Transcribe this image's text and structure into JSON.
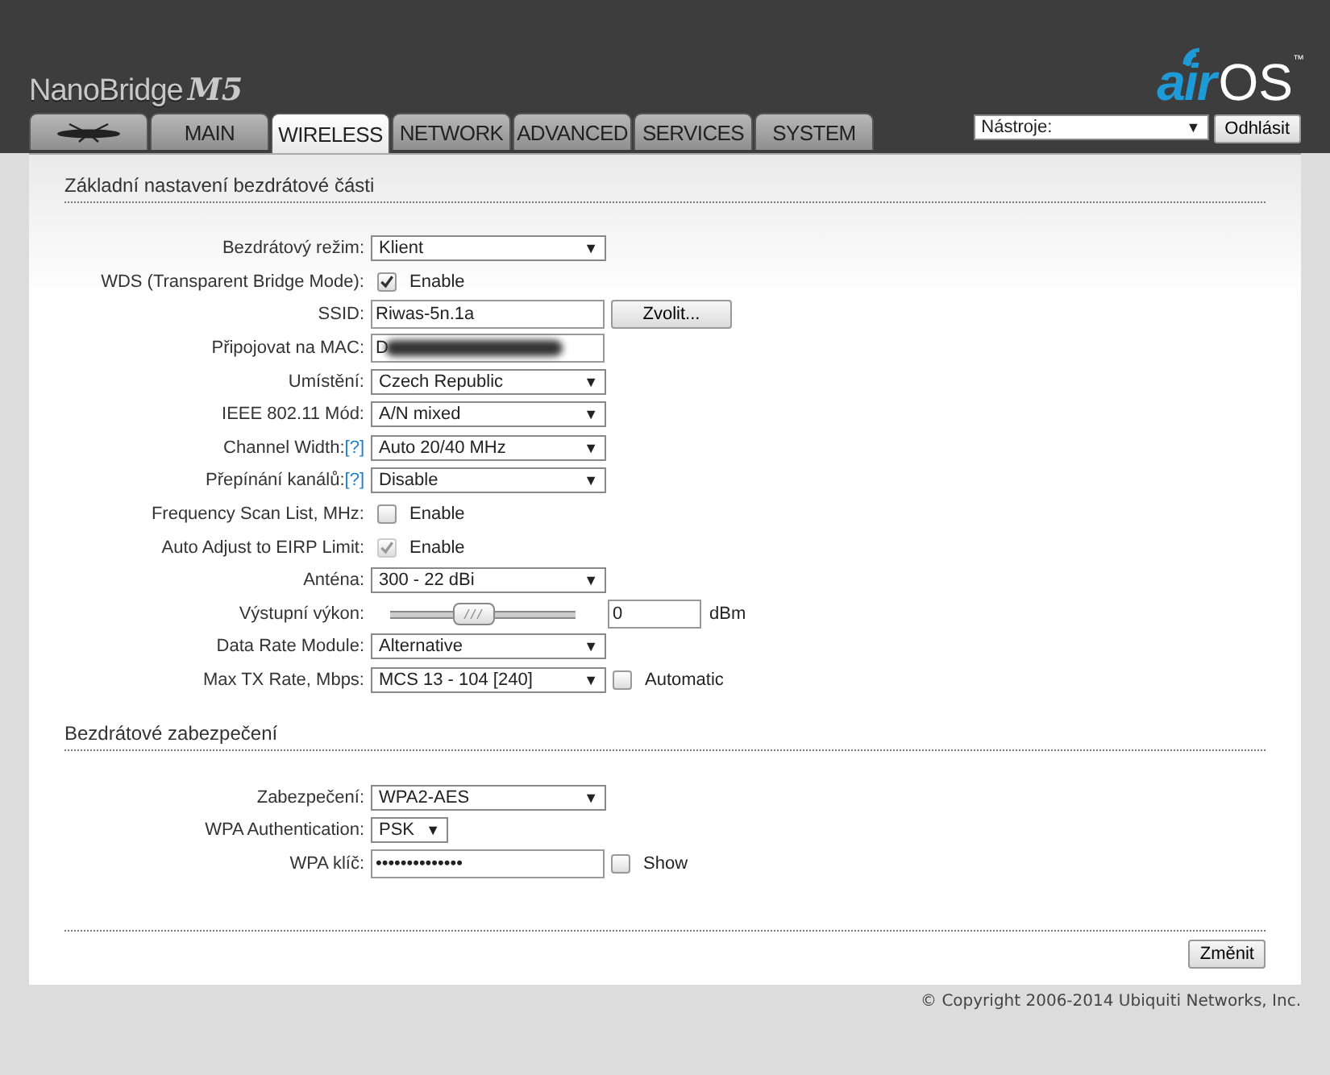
{
  "header": {
    "product": "NanoBridge",
    "model": "M5",
    "brand_left": "air",
    "brand_right": "OS",
    "trademark": "™"
  },
  "tabs": [
    {
      "kind": "logo",
      "selected": false
    },
    {
      "label": "MAIN",
      "selected": false
    },
    {
      "label": "WIRELESS",
      "selected": true
    },
    {
      "label": "NETWORK",
      "selected": false
    },
    {
      "label": "ADVANCED",
      "selected": false
    },
    {
      "label": "SERVICES",
      "selected": false
    },
    {
      "label": "SYSTEM",
      "selected": false
    }
  ],
  "tools": {
    "select": "Nástroje:",
    "arrow": "▼",
    "logout": "Odhlásit"
  },
  "sections": [
    {
      "title": "Základní nastavení bezdrátové části",
      "rows": [
        {
          "kind": "select",
          "label": "Bezdrátový režim:",
          "value": "Klient",
          "arrow": "▼"
        },
        {
          "kind": "checkbox",
          "label": "WDS (Transparent Bridge Mode):",
          "checked": true,
          "disabled": false,
          "option": "Enable"
        },
        {
          "kind": "text",
          "label": "SSID:",
          "value": "Riwas-5n.1a",
          "button": "Zvolit..."
        },
        {
          "kind": "text",
          "label": "Připojovat na MAC:",
          "value": "D",
          "redacted": true
        },
        {
          "kind": "select",
          "label": "Umístění:",
          "value": "Czech Republic",
          "arrow": "▼"
        },
        {
          "kind": "select",
          "label": "IEEE 802.11 Mód:",
          "value": "A/N mixed",
          "arrow": "▼"
        },
        {
          "kind": "select",
          "label": "Channel Width:",
          "help": "[?]",
          "value": "Auto 20/40 MHz",
          "arrow": "▼"
        },
        {
          "kind": "select",
          "label": "Přepínání kanálů:",
          "help": "[?]",
          "value": "Disable",
          "arrow": "▼"
        },
        {
          "kind": "checkbox",
          "label": "Frequency Scan List, MHz:",
          "checked": false,
          "disabled": false,
          "option": "Enable"
        },
        {
          "kind": "checkbox",
          "label": "Auto Adjust to EIRP Limit:",
          "checked": true,
          "disabled": true,
          "option": "Enable"
        },
        {
          "kind": "select",
          "label": "Anténa:",
          "value": "300 - 22 dBi",
          "arrow": "▼"
        },
        {
          "kind": "slider",
          "label": "Výstupní výkon:",
          "level": 0.45,
          "value": "0",
          "unit": "dBm"
        },
        {
          "kind": "select",
          "label": "Data Rate Module:",
          "value": "Alternative",
          "arrow": "▼"
        },
        {
          "kind": "select",
          "label": "Max TX Rate, Mbps:",
          "value": "MCS 13 - 104 [240]",
          "arrow": "▼",
          "checked": false,
          "option": "Automatic"
        }
      ]
    },
    {
      "title": "Bezdrátové zabezpečení",
      "rows": [
        {
          "kind": "select",
          "label": "Zabezpečení:",
          "value": "WPA2-AES",
          "arrow": "▼"
        },
        {
          "kind": "select",
          "label": "WPA Authentication:",
          "value": "PSK",
          "arrow": "▼",
          "narrow": true
        },
        {
          "kind": "password",
          "label": "WPA klíč:",
          "value": "••••••••••••••",
          "checked": false,
          "option": "Show"
        }
      ]
    }
  ],
  "submit": "Změnit",
  "copyright": "© Copyright 2006-2014 Ubiquiti Networks, Inc."
}
